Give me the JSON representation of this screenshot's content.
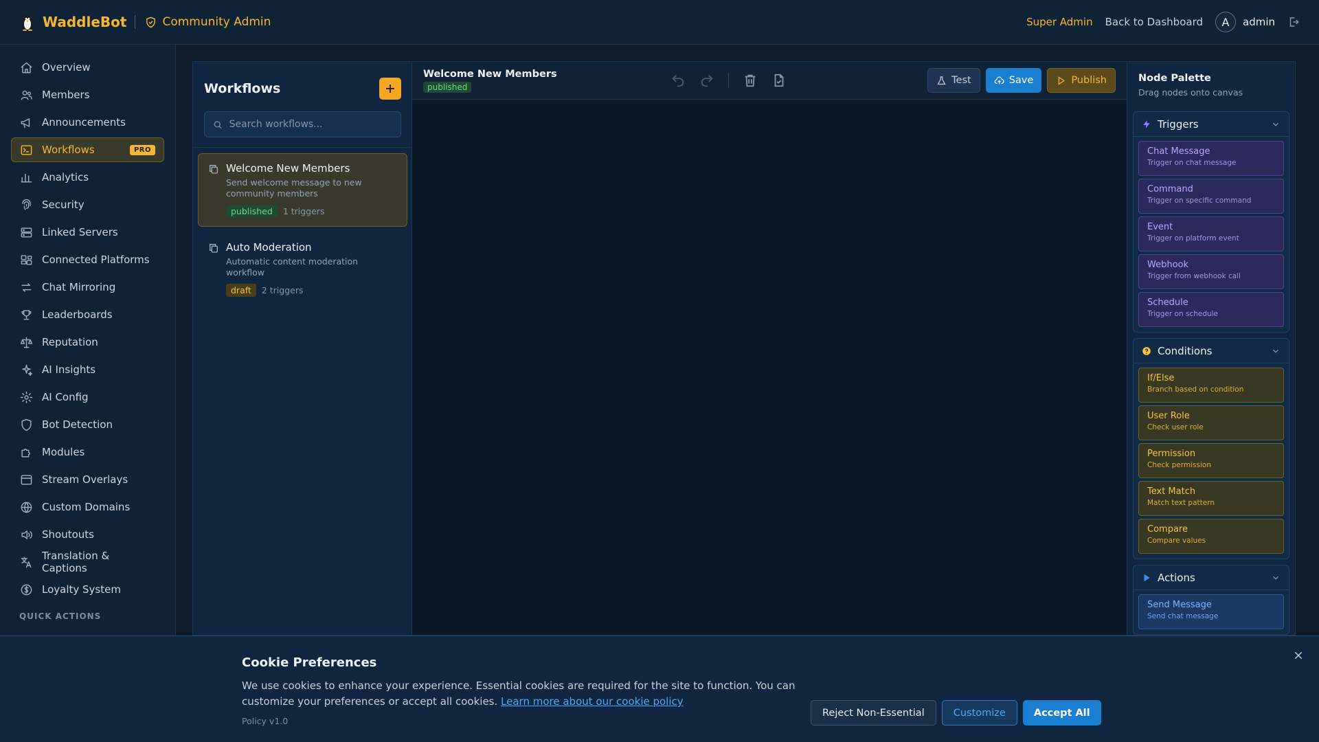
{
  "header": {
    "brand": "WaddleBot",
    "section": "Community Admin",
    "super_admin": "Super Admin",
    "back": "Back to Dashboard",
    "avatar_letter": "A",
    "username": "admin"
  },
  "sidebar": {
    "items": [
      {
        "label": "Overview",
        "icon": "home-icon"
      },
      {
        "label": "Members",
        "icon": "users-icon"
      },
      {
        "label": "Announcements",
        "icon": "megaphone-icon"
      },
      {
        "label": "Workflows",
        "icon": "terminal-icon",
        "badge": "PRO",
        "active": true
      },
      {
        "label": "Analytics",
        "icon": "bar-chart-icon"
      },
      {
        "label": "Security",
        "icon": "fingerprint-icon"
      },
      {
        "label": "Linked Servers",
        "icon": "server-icon"
      },
      {
        "label": "Connected Platforms",
        "icon": "platforms-icon"
      },
      {
        "label": "Chat Mirroring",
        "icon": "arrows-icon"
      },
      {
        "label": "Leaderboards",
        "icon": "trophy-icon"
      },
      {
        "label": "Reputation",
        "icon": "scale-icon"
      },
      {
        "label": "AI Insights",
        "icon": "sparkles-icon"
      },
      {
        "label": "AI Config",
        "icon": "gear-icon"
      },
      {
        "label": "Bot Detection",
        "icon": "shield-icon"
      },
      {
        "label": "Modules",
        "icon": "puzzle-icon"
      },
      {
        "label": "Stream Overlays",
        "icon": "window-icon"
      },
      {
        "label": "Custom Domains",
        "icon": "globe-icon"
      },
      {
        "label": "Shoutouts",
        "icon": "speaker-icon"
      },
      {
        "label": "Translation & Captions",
        "icon": "translate-icon"
      },
      {
        "label": "Loyalty System",
        "icon": "dollar-icon"
      }
    ],
    "quick_actions": "QUICK ACTIONS"
  },
  "workflows": {
    "title": "Workflows",
    "search_placeholder": "Search workflows...",
    "items": [
      {
        "name": "Welcome New Members",
        "desc": "Send welcome message to new community members",
        "status": "published",
        "triggers": "1 triggers"
      },
      {
        "name": "Auto Moderation",
        "desc": "Automatic content moderation workflow",
        "status": "draft",
        "triggers": "2 triggers"
      }
    ]
  },
  "editor": {
    "title": "Welcome New Members",
    "status": "published",
    "test": "Test",
    "save": "Save",
    "publish": "Publish"
  },
  "palette": {
    "title": "Node Palette",
    "subtitle": "Drag nodes onto canvas",
    "triggers": {
      "label": "Triggers",
      "nodes": [
        {
          "name": "Chat Message",
          "desc": "Trigger on chat message"
        },
        {
          "name": "Command",
          "desc": "Trigger on specific command"
        },
        {
          "name": "Event",
          "desc": "Trigger on platform event"
        },
        {
          "name": "Webhook",
          "desc": "Trigger from webhook call"
        },
        {
          "name": "Schedule",
          "desc": "Trigger on schedule"
        }
      ]
    },
    "conditions": {
      "label": "Conditions",
      "nodes": [
        {
          "name": "If/Else",
          "desc": "Branch based on condition"
        },
        {
          "name": "User Role",
          "desc": "Check user role"
        },
        {
          "name": "Permission",
          "desc": "Check permission"
        },
        {
          "name": "Text Match",
          "desc": "Match text pattern"
        },
        {
          "name": "Compare",
          "desc": "Compare values"
        }
      ]
    },
    "actions": {
      "label": "Actions",
      "nodes": [
        {
          "name": "Send Message",
          "desc": "Send chat message"
        }
      ]
    }
  },
  "cookie": {
    "title": "Cookie Preferences",
    "text": "We use cookies to enhance your experience. Essential cookies are required for the site to function. You can customize your preferences or accept all cookies.",
    "link": "Learn more about our cookie policy",
    "policy": "Policy v1.0",
    "reject": "Reject Non-Essential",
    "customize": "Customize",
    "accept": "Accept All"
  },
  "colors": {
    "accent": "#f5b731",
    "primary": "#1a7fd1",
    "background": "#0c1a2b"
  }
}
